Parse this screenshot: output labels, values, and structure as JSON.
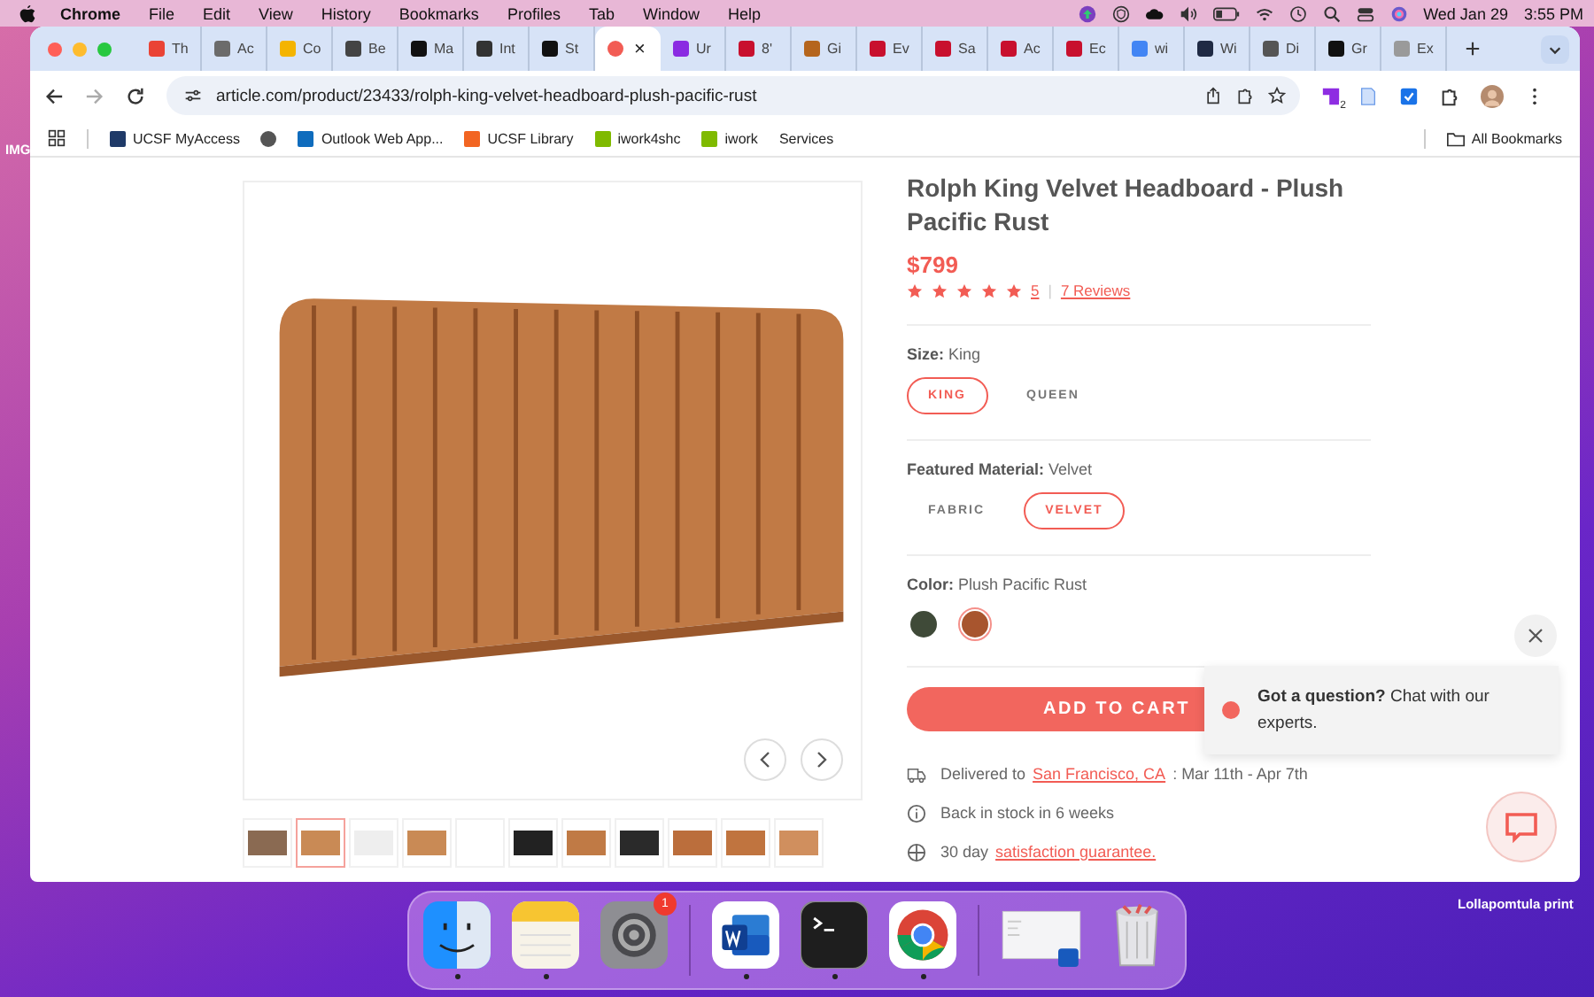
{
  "menu_bar": {
    "app": "Chrome",
    "menus": [
      "File",
      "Edit",
      "View",
      "History",
      "Bookmarks",
      "Profiles",
      "Tab",
      "Window",
      "Help"
    ],
    "date": "Wed Jan 29",
    "time": "3:55 PM"
  },
  "desktop_labels": [
    "IMG",
    "Lollapomtula print"
  ],
  "tabs": [
    {
      "title": "Th",
      "selected": false,
      "color": "#ea4335"
    },
    {
      "title": "Ac",
      "selected": false,
      "color": "#6b6b6b"
    },
    {
      "title": "Co",
      "selected": false,
      "color": "#f4b400"
    },
    {
      "title": "Be",
      "selected": false,
      "color": "#444444"
    },
    {
      "title": "Ma",
      "selected": false,
      "color": "#111111"
    },
    {
      "title": "Int",
      "selected": false,
      "color": "#333333"
    },
    {
      "title": "St",
      "selected": false,
      "color": "#111111"
    },
    {
      "title": "×",
      "selected": true,
      "color": "#f25c54"
    },
    {
      "title": "Ur",
      "selected": false,
      "color": "#8a2be2"
    },
    {
      "title": "8'",
      "selected": false,
      "color": "#c8102e"
    },
    {
      "title": "Gi",
      "selected": false,
      "color": "#b5651d"
    },
    {
      "title": "Ev",
      "selected": false,
      "color": "#c8102e"
    },
    {
      "title": "Sa",
      "selected": false,
      "color": "#c8102e"
    },
    {
      "title": "Ac",
      "selected": false,
      "color": "#c8102e"
    },
    {
      "title": "Ec",
      "selected": false,
      "color": "#c8102e"
    },
    {
      "title": "wi",
      "selected": false,
      "color": "#4285f4"
    },
    {
      "title": "Wi",
      "selected": false,
      "color": "#1f2a44"
    },
    {
      "title": "Di",
      "selected": false,
      "color": "#555555"
    },
    {
      "title": "Gr",
      "selected": false,
      "color": "#111111"
    },
    {
      "title": "Ex",
      "selected": false,
      "color": "#9a9a9a"
    }
  ],
  "address": {
    "url": "article.com/product/23433/rolph-king-velvet-headboard-plush-pacific-rust"
  },
  "extension_badge": "2",
  "bookmarks": [
    {
      "label": "UCSF MyAccess",
      "color": "#1f3a68"
    },
    {
      "kind": "globe",
      "color": "#555555"
    },
    {
      "label": "Outlook Web App...",
      "color": "#0f6cbd"
    },
    {
      "label": "UCSF Library",
      "color": "#f26522"
    },
    {
      "label": "iwork4shc",
      "color": "#7fba00"
    },
    {
      "label": "iwork",
      "color": "#7fba00"
    },
    {
      "label": "Services"
    }
  ],
  "all_bookmarks": "All Bookmarks",
  "product": {
    "title": "Rolph King Velvet Headboard - Plush Pacific Rust",
    "price": "$799",
    "stars": 5,
    "rating": "5",
    "separator": "|",
    "reviews": "7 Reviews"
  },
  "options": [
    {
      "kind": "pill",
      "label": "Size:",
      "value": "King",
      "choices": [
        {
          "label": "KING",
          "selected": true
        },
        {
          "label": "QUEEN",
          "selected": false
        }
      ]
    },
    {
      "kind": "pill",
      "label": "Featured Material:",
      "value": "Velvet",
      "choices": [
        {
          "label": "FABRIC",
          "selected": false
        },
        {
          "label": "VELVET",
          "selected": true
        }
      ]
    },
    {
      "kind": "swatch",
      "label": "Color:",
      "value": "Plush Pacific Rust",
      "choices": [
        {
          "color": "#3f4a38",
          "selected": false
        },
        {
          "color": "#a8552e",
          "selected": true
        }
      ]
    }
  ],
  "add_to_cart": "ADD TO CART",
  "info": [
    {
      "kind": "truck",
      "text": "Delivered to",
      "link": "San Francisco, CA",
      "suffix": ": Mar 11th - Apr 7th"
    },
    {
      "kind": "info",
      "text": "Back in stock in 6 weeks"
    },
    {
      "kind": "shield",
      "text": "30 day",
      "link": "satisfaction guarantee."
    }
  ],
  "thumbnails": [
    {
      "selected": false
    },
    {
      "selected": true
    },
    {
      "selected": false
    },
    {
      "selected": false
    },
    {
      "selected": false
    },
    {
      "selected": false
    },
    {
      "selected": false
    },
    {
      "selected": false
    },
    {
      "selected": false
    },
    {
      "selected": false
    },
    {
      "selected": false
    }
  ],
  "chat": {
    "message": "**Got a question?** Chat with our experts."
  },
  "dock": [
    {
      "kind": "finder",
      "running": true
    },
    {
      "kind": "notes",
      "running": true
    },
    {
      "kind": "settings",
      "running": false,
      "badge": "1"
    },
    {
      "kind": "divider"
    },
    {
      "kind": "word",
      "running": true
    },
    {
      "kind": "terminal",
      "running": true
    },
    {
      "kind": "chrome",
      "running": true
    },
    {
      "kind": "divider"
    },
    {
      "kind": "window",
      "running": false
    },
    {
      "kind": "trash",
      "running": false
    }
  ]
}
